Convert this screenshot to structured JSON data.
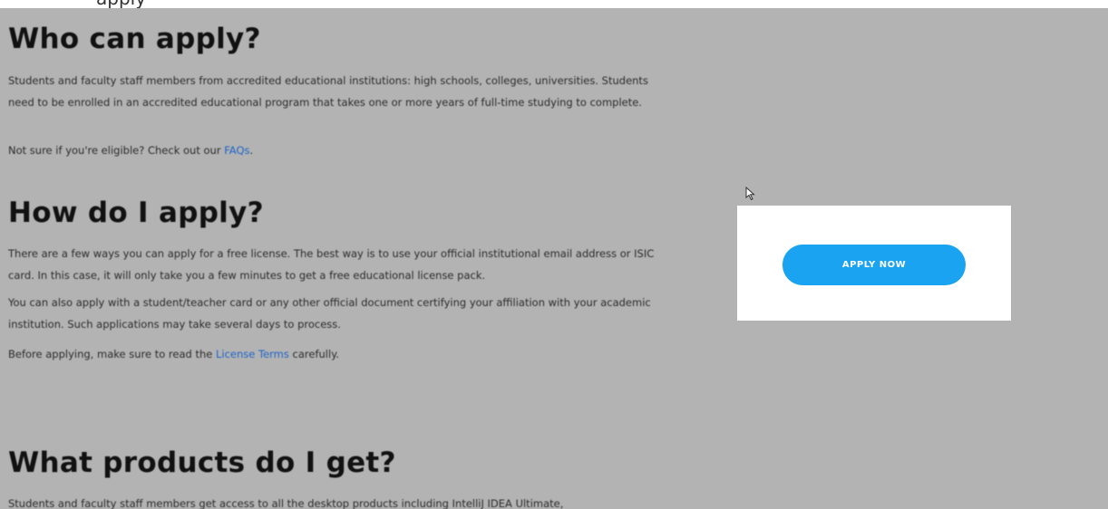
{
  "top_strip": {
    "text": "apply"
  },
  "sections": {
    "who": {
      "title": "Who can apply?",
      "p1": "Students and faculty staff members from accredited educational institutions: high schools, colleges, universities. Students need to be enrolled in an accredited educational program that takes one or more years of full-time studying to complete.",
      "p2_before": "Not sure if you're eligible? Check out our ",
      "p2_link": "FAQs",
      "p2_after": "."
    },
    "how": {
      "title": "How do I apply?",
      "p1": "There are a few ways you can apply for a free license. The best way is to use your official institutional email address or ISIC card. In this case, it will only take you a few minutes to get a free educational license pack.",
      "p2": "You can also apply with a student/teacher card or any other official document certifying your affiliation with your academic institution. Such applications may take several days to process.",
      "p3_before": "Before applying, make sure to read the ",
      "p3_link": "License Terms",
      "p3_after": " carefully."
    },
    "what": {
      "title": "What products do I get?",
      "p1": "Students and faculty staff members get access to all the desktop products including IntelliJ IDEA Ultimate,"
    }
  },
  "modal": {
    "button_label": "APPLY NOW"
  },
  "colors": {
    "overlay": "#b3b3b3",
    "button": "#1aa3f0",
    "link": "#1e64c8"
  },
  "icons": {
    "cursor": "mouse-pointer-icon"
  }
}
